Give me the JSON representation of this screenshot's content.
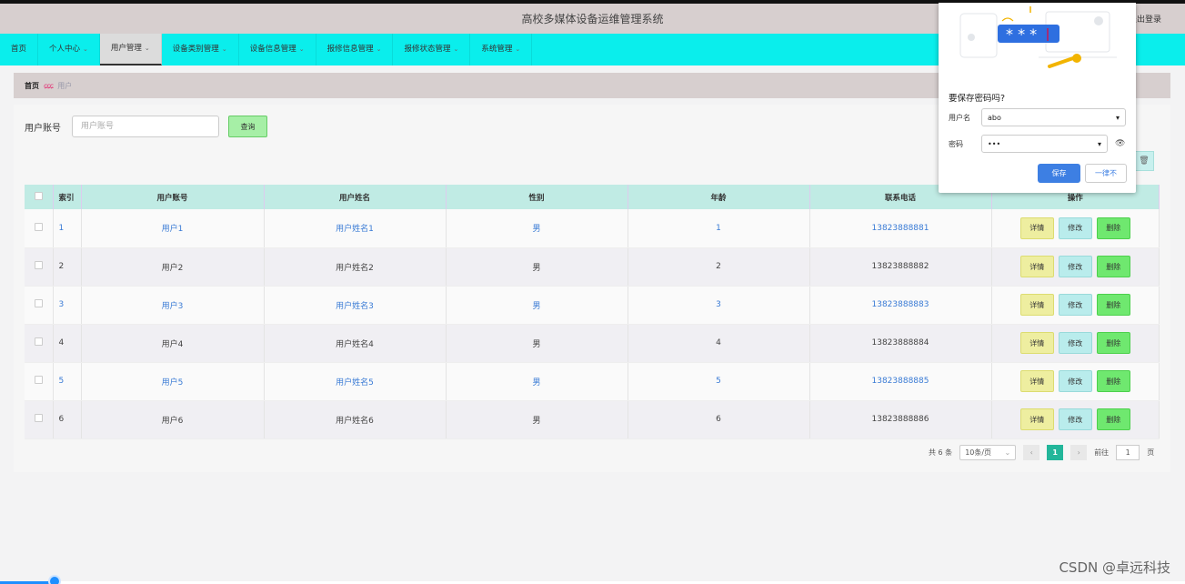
{
  "header": {
    "title": "高校多媒体设备运维管理系统",
    "logout": "退出登录"
  },
  "menu": [
    {
      "label": "首页",
      "has_dropdown": false,
      "active": false
    },
    {
      "label": "个人中心",
      "has_dropdown": true,
      "active": false
    },
    {
      "label": "用户管理",
      "has_dropdown": true,
      "active": true
    },
    {
      "label": "设备类别管理",
      "has_dropdown": true,
      "active": false
    },
    {
      "label": "设备信息管理",
      "has_dropdown": true,
      "active": false
    },
    {
      "label": "报修信息管理",
      "has_dropdown": true,
      "active": false
    },
    {
      "label": "报修状态管理",
      "has_dropdown": true,
      "active": false
    },
    {
      "label": "系统管理",
      "has_dropdown": true,
      "active": false
    }
  ],
  "breadcrumb": {
    "home": "首页",
    "separator": "ɕɕɕ",
    "current": "用户"
  },
  "search": {
    "label": "用户账号",
    "placeholder": "用户账号",
    "query_button": "查询"
  },
  "table": {
    "headers": [
      "索引",
      "用户账号",
      "用户姓名",
      "性别",
      "年龄",
      "联系电话",
      "操作"
    ],
    "rows": [
      {
        "index": "1",
        "account": "用户1",
        "name": "用户姓名1",
        "gender": "男",
        "age": "1",
        "phone": "13823888881"
      },
      {
        "index": "2",
        "account": "用户2",
        "name": "用户姓名2",
        "gender": "男",
        "age": "2",
        "phone": "13823888882"
      },
      {
        "index": "3",
        "account": "用户3",
        "name": "用户姓名3",
        "gender": "男",
        "age": "3",
        "phone": "13823888883"
      },
      {
        "index": "4",
        "account": "用户4",
        "name": "用户姓名4",
        "gender": "男",
        "age": "4",
        "phone": "13823888884"
      },
      {
        "index": "5",
        "account": "用户5",
        "name": "用户姓名5",
        "gender": "男",
        "age": "5",
        "phone": "13823888885"
      },
      {
        "index": "6",
        "account": "用户6",
        "name": "用户姓名6",
        "gender": "男",
        "age": "6",
        "phone": "13823888886"
      }
    ],
    "actions": {
      "detail": "详情",
      "edit": "修改",
      "delete": "删除"
    }
  },
  "pagination": {
    "total": "共 6 条",
    "page_size": "10条/页",
    "current_page": "1",
    "goto_label": "前往",
    "goto_value": "1",
    "page_unit": "页"
  },
  "password_popup": {
    "illustration_text": "* * *",
    "title": "要保存密码吗?",
    "username_label": "用户名",
    "username_value": "abo",
    "password_label": "密码",
    "password_value": "•••",
    "save_button": "保存",
    "never_button": "一律不"
  },
  "watermark": "CSDN @卓远科技",
  "colors": {
    "menu_bg": "#0aeeec",
    "header_bg": "#d7cfcf",
    "table_header_bg": "#c0ebe4",
    "link_blue": "#3a7bd5",
    "page_active": "#23b69a",
    "save_blue": "#3d7fe3"
  }
}
